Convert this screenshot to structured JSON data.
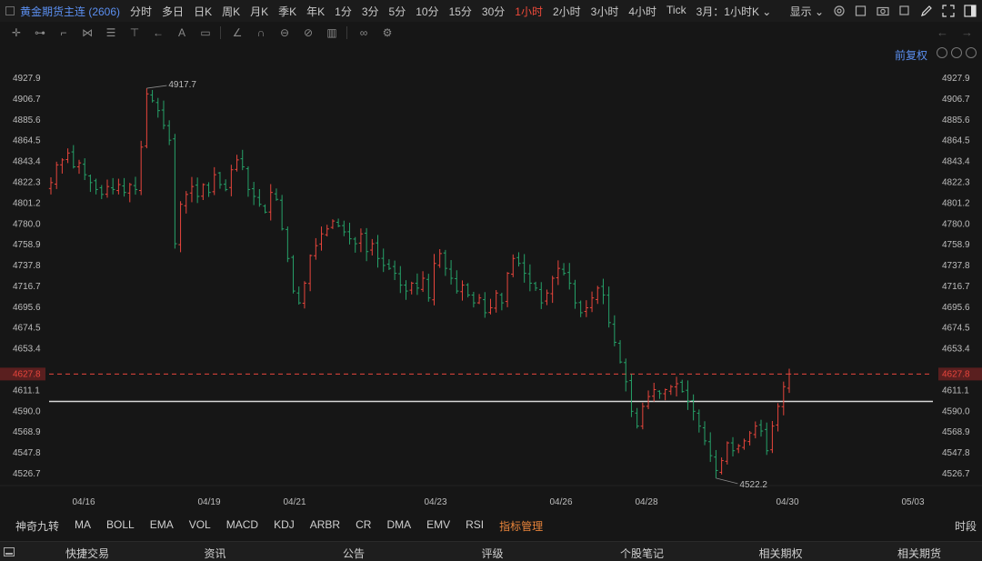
{
  "header": {
    "symbol": "黄金期货主连 (2606)",
    "periods": [
      "分时",
      "多日",
      "日K",
      "周K",
      "月K",
      "季K",
      "年K",
      "1分",
      "3分",
      "5分",
      "10分",
      "15分",
      "30分",
      "1小时",
      "2小时",
      "3小时",
      "4小时",
      "Tick",
      "3月：1小时K ⌄"
    ],
    "active_period": "1小时",
    "display_label": "显示"
  },
  "adjust_label": "前复权",
  "bottom_tabs": [
    "快捷交易",
    "资讯",
    "公告",
    "评级",
    "个股笔记",
    "相关期权",
    "相关期货"
  ],
  "indicators": [
    "神奇九转",
    "MA",
    "BOLL",
    "EMA",
    "VOL",
    "MACD",
    "KDJ",
    "ARBR",
    "CR",
    "DMA",
    "EMV",
    "RSI",
    "指标管理"
  ],
  "time_share_label": "时段",
  "colors": {
    "up": "#e8453c",
    "down": "#26a269",
    "accent": "#5b8ff0",
    "price_line": "#e8453c",
    "bg": "#161616"
  },
  "chart_data": {
    "type": "candlestick",
    "y_ticks": [
      "4927.9",
      "4906.7",
      "4885.6",
      "4864.5",
      "4843.4",
      "4822.3",
      "4801.2",
      "4780.0",
      "4758.9",
      "4737.8",
      "4716.7",
      "4695.6",
      "4674.5",
      "4653.4",
      "4627.8",
      "4611.1",
      "4590.0",
      "4568.9",
      "4547.8",
      "4526.7"
    ],
    "ylim": [
      4526.7,
      4927.9
    ],
    "x_labels": [
      "04/16",
      "04/19",
      "04/21",
      "04/23",
      "04/26",
      "04/28",
      "04/30",
      "05/03"
    ],
    "current_price": 4627.8,
    "support_line": 4600.0,
    "high_label": "4917.7",
    "low_label": "4522.2",
    "close_path": [
      4822,
      4840,
      4845,
      4852,
      4838,
      4842,
      4830,
      4822,
      4815,
      4810,
      4818,
      4815,
      4820,
      4812,
      4820,
      4815,
      4858,
      4912,
      4905,
      4895,
      4880,
      4865,
      4760,
      4800,
      4810,
      4818,
      4808,
      4820,
      4812,
      4830,
      4820,
      4815,
      4835,
      4845,
      4838,
      4815,
      4808,
      4800,
      4792,
      4812,
      4805,
      4775,
      4745,
      4712,
      4700,
      4720,
      4748,
      4758,
      4770,
      4775,
      4783,
      4778,
      4772,
      4765,
      4760,
      4770,
      4752,
      4760,
      4745,
      4738,
      4735,
      4730,
      4718,
      4712,
      4720,
      4715,
      4725,
      4705,
      4740,
      4750,
      4735,
      4725,
      4712,
      4718,
      4708,
      4700,
      4705,
      4690,
      4695,
      4710,
      4700,
      4730,
      4745,
      4740,
      4730,
      4720,
      4715,
      4700,
      4710,
      4725,
      4735,
      4730,
      4720,
      4700,
      4690,
      4695,
      4705,
      4715,
      4708,
      4680,
      4660,
      4640,
      4620,
      4590,
      4575,
      4595,
      4605,
      4612,
      4608,
      4612,
      4615,
      4618,
      4610,
      4600,
      4590,
      4575,
      4560,
      4545,
      4530,
      4540,
      4558,
      4550,
      4555,
      4560,
      4568,
      4575,
      4570,
      4550,
      4575,
      4595,
      4615,
      4627.8
    ]
  }
}
